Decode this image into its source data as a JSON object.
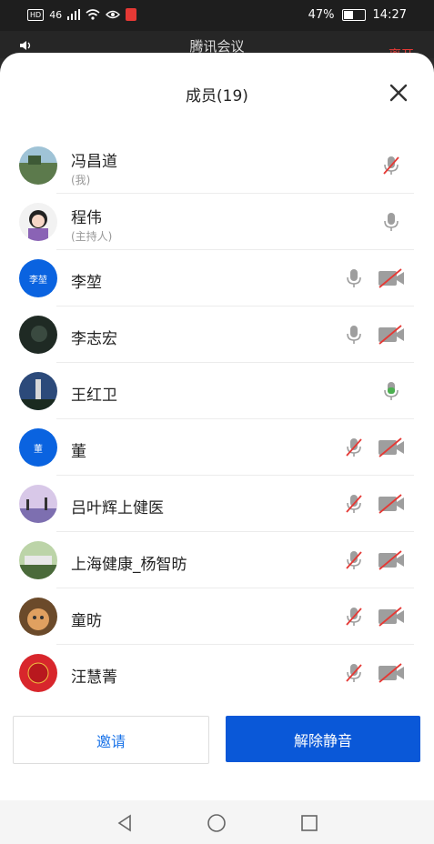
{
  "status_bar": {
    "network": "HD",
    "signal": "46",
    "battery": "47%",
    "time": "14:27"
  },
  "app": {
    "title": "腾讯会议",
    "end_label": "离开"
  },
  "panel": {
    "title": "成员(19)"
  },
  "members": [
    {
      "name": "冯昌道",
      "role": "(我)",
      "avatar": "photo-lake",
      "mic": "muted",
      "camera": "none"
    },
    {
      "name": "程伟",
      "role": "(主持人)",
      "avatar": "photo-cartoon",
      "mic": "on",
      "camera": "none"
    },
    {
      "name": "李堃",
      "role": "",
      "avatar_text": "李堃",
      "mic": "on",
      "camera": "off"
    },
    {
      "name": "李志宏",
      "role": "",
      "avatar": "photo-dark",
      "mic": "on",
      "camera": "off"
    },
    {
      "name": "王红卫",
      "role": "",
      "avatar": "photo-tower",
      "mic": "speaking",
      "camera": "none"
    },
    {
      "name": "董",
      "role": "",
      "avatar_text": "董",
      "mic": "muted",
      "camera": "off"
    },
    {
      "name": "吕叶辉上健医",
      "role": "",
      "avatar": "photo-sunset",
      "mic": "muted",
      "camera": "off"
    },
    {
      "name": "上海健康_杨智昉",
      "role": "",
      "avatar": "photo-garden",
      "mic": "muted",
      "camera": "off"
    },
    {
      "name": "童昉",
      "role": "",
      "avatar": "photo-cat",
      "mic": "muted",
      "camera": "off"
    },
    {
      "name": "汪慧菁",
      "role": "",
      "avatar": "photo-red",
      "mic": "muted",
      "camera": "off"
    }
  ],
  "actions": {
    "invite": "邀请",
    "unmute_all": "解除静音"
  },
  "colors": {
    "accent": "#0a58d8",
    "muted_slash": "#e53935",
    "speaking": "#4caf50",
    "icon_gray": "#9e9e9e"
  }
}
